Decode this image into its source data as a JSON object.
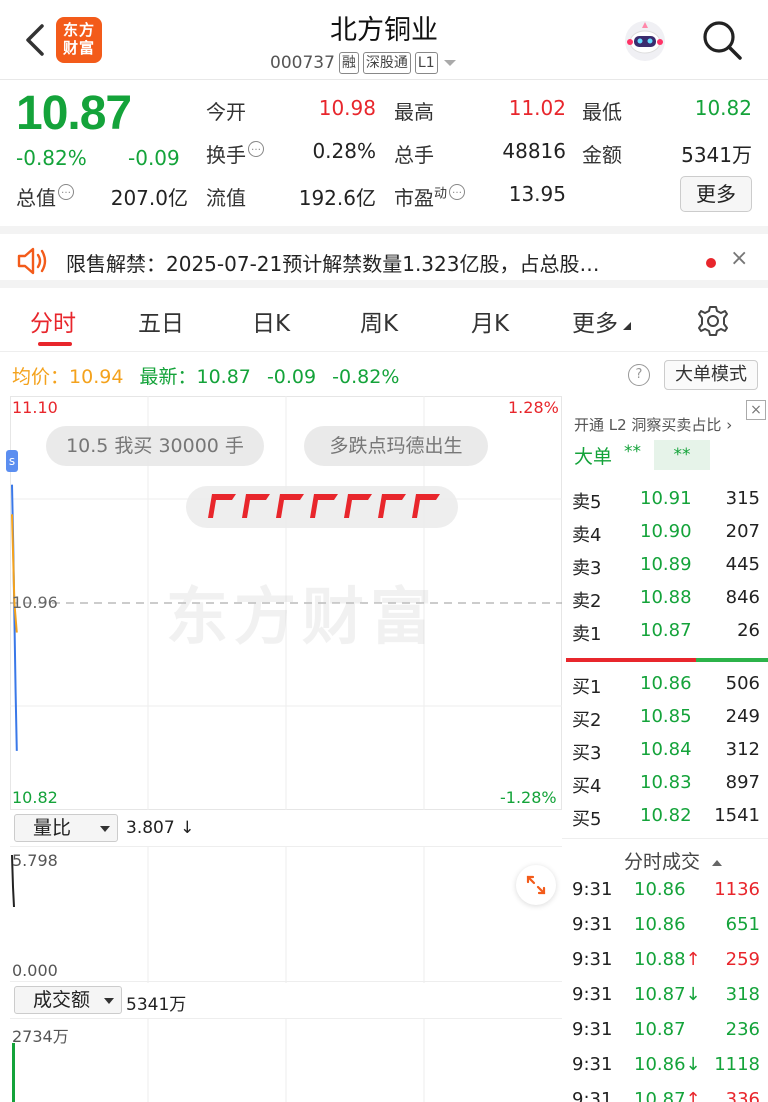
{
  "header": {
    "back_icon": "chevron-left-icon",
    "logo_line1": "东方",
    "logo_line2": "财富",
    "stock_name": "北方铜业",
    "stock_code": "000737",
    "tags": [
      "融",
      "深股通",
      "L1"
    ],
    "robot_icon": "robot-assistant-icon",
    "search_icon": "search-icon"
  },
  "quote": {
    "price": "10.87",
    "change_pct": "-0.82%",
    "change": "-0.09",
    "open_label": "今开",
    "open": "10.98",
    "high_label": "最高",
    "high": "11.02",
    "low_label": "最低",
    "low": "10.82",
    "turnover_label": "换手",
    "turnover": "0.28%",
    "volume_label": "总手",
    "volume": "48816",
    "amount_label": "金额",
    "amount": "5341万",
    "mktcap_label": "总值",
    "mktcap": "207.0亿",
    "float_label": "流值",
    "float_cap": "192.6亿",
    "pe_label": "市盈",
    "pe_sup": "动",
    "pe": "13.95",
    "more_button": "更多",
    "colors": {
      "up": "#e8262c",
      "down": "#14a33a"
    }
  },
  "notice": {
    "icon": "speaker-icon",
    "text": "限售解禁：2025-07-21预计解禁数量1.323亿股，占总股…",
    "close": "×"
  },
  "tabs": [
    {
      "label": "分时",
      "active": true
    },
    {
      "label": "五日"
    },
    {
      "label": "日K"
    },
    {
      "label": "周K"
    },
    {
      "label": "月K"
    },
    {
      "label": "更多"
    }
  ],
  "settings_icon": "gear-icon",
  "summary": {
    "avg_label": "均价：",
    "avg": "10.94",
    "latest_label": "最新：",
    "latest": "10.87",
    "change": "-0.09",
    "change_pct": "-0.82%",
    "help": "?",
    "mode_button": "大单模式"
  },
  "chart": {
    "y_top": "11.10",
    "y_mid": "10.96",
    "y_bottom": "10.82",
    "pct_top": "1.28%",
    "pct_bottom": "-1.28%",
    "bubble1": "10.5 我买 30000 手",
    "bubble2": "多跌点玛德出生",
    "watermark": "东方财富"
  },
  "chart_data": {
    "type": "line",
    "title": "",
    "y_range": [
      10.82,
      11.1
    ],
    "prev_close": 10.96,
    "series": [
      {
        "values": [
          11.04,
          11.0,
          10.95,
          10.9,
          10.86
        ]
      },
      {
        "values": [
          11.02,
          10.99,
          10.96,
          10.95,
          10.94
        ]
      }
    ]
  },
  "book": {
    "l2_promo": "开通 L2 洞察买卖占比",
    "big_order_label": "大单",
    "big_order_v1": "**",
    "big_order_v2": "**",
    "sells": [
      {
        "label": "卖5",
        "price": "10.91",
        "vol": "315"
      },
      {
        "label": "卖4",
        "price": "10.90",
        "vol": "207"
      },
      {
        "label": "卖3",
        "price": "10.89",
        "vol": "445"
      },
      {
        "label": "卖2",
        "price": "10.88",
        "vol": "846"
      },
      {
        "label": "卖1",
        "price": "10.87",
        "vol": "26"
      }
    ],
    "buys": [
      {
        "label": "买1",
        "price": "10.86",
        "vol": "506"
      },
      {
        "label": "买2",
        "price": "10.85",
        "vol": "249"
      },
      {
        "label": "买3",
        "price": "10.84",
        "vol": "312"
      },
      {
        "label": "买4",
        "price": "10.83",
        "vol": "897"
      },
      {
        "label": "买5",
        "price": "10.82",
        "vol": "1541"
      }
    ]
  },
  "vol_pane": {
    "selector": "量比",
    "value": "3.807 ↓",
    "y_top": "5.798",
    "y_bottom": "0.000"
  },
  "amount_pane": {
    "selector": "成交额",
    "value": "5341万",
    "y_top": "2734万"
  },
  "ticks": {
    "title": "分时成交",
    "rows": [
      {
        "time": "9:31",
        "price": "10.86",
        "arrow": "",
        "vol": "1136",
        "vol_color": "red"
      },
      {
        "time": "9:31",
        "price": "10.86",
        "arrow": "",
        "vol": "651",
        "vol_color": "green"
      },
      {
        "time": "9:31",
        "price": "10.88",
        "arrow": "↑",
        "vol": "259",
        "vol_color": "red"
      },
      {
        "time": "9:31",
        "price": "10.87",
        "arrow": "↓",
        "vol": "318",
        "vol_color": "green"
      },
      {
        "time": "9:31",
        "price": "10.87",
        "arrow": "",
        "vol": "236",
        "vol_color": "green"
      },
      {
        "time": "9:31",
        "price": "10.86",
        "arrow": "↓",
        "vol": "1118",
        "vol_color": "green"
      },
      {
        "time": "9:31",
        "price": "10.87",
        "arrow": "↑",
        "vol": "336",
        "vol_color": "red"
      }
    ]
  }
}
